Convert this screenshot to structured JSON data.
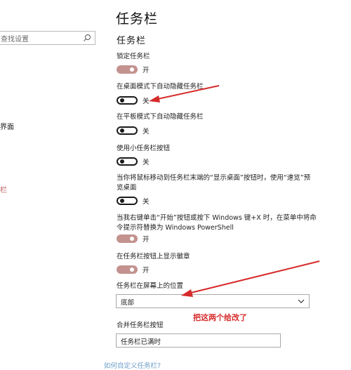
{
  "left_pane": {
    "search_placeholder": "查找设置",
    "frag_item1": "界面",
    "frag_item2": "栏"
  },
  "page_title": "任务栏",
  "section_title": "任务栏",
  "settings": [
    {
      "label": "锁定任务栏",
      "state": "开",
      "on": true
    },
    {
      "label": "在桌面模式下自动隐藏任务栏",
      "state": "关",
      "on": false
    },
    {
      "label": "在平板模式下自动隐藏任务栏",
      "state": "关",
      "on": false
    },
    {
      "label": "使用小任务栏按钮",
      "state": "关",
      "on": false
    },
    {
      "label_line1": "当你将鼠标移动到任务栏末端的“显示桌面”按钮时，使用“速览”预",
      "label_line2": "览桌面",
      "state": "关",
      "on": false
    },
    {
      "label_line1": "当我右键单击“开始”按钮或按下 Windows 键+X 时，在菜单中将命",
      "label_line2": "令提示符替换为 Windows PowerShell",
      "state": "开",
      "on": true
    },
    {
      "label": "在任务栏按钮上显示徽章",
      "state": "开",
      "on": true
    }
  ],
  "position": {
    "label": "任务栏在屏幕上的位置",
    "value": "底部"
  },
  "combine": {
    "label": "合并任务栏按钮",
    "value": "任务栏已满时"
  },
  "annotation": "把这两个给改了",
  "link": "如何自定义任务栏?",
  "colors": {
    "toggle_on": "#c3928f",
    "arrow": "#d62a2a",
    "link": "#6fa0cc"
  }
}
